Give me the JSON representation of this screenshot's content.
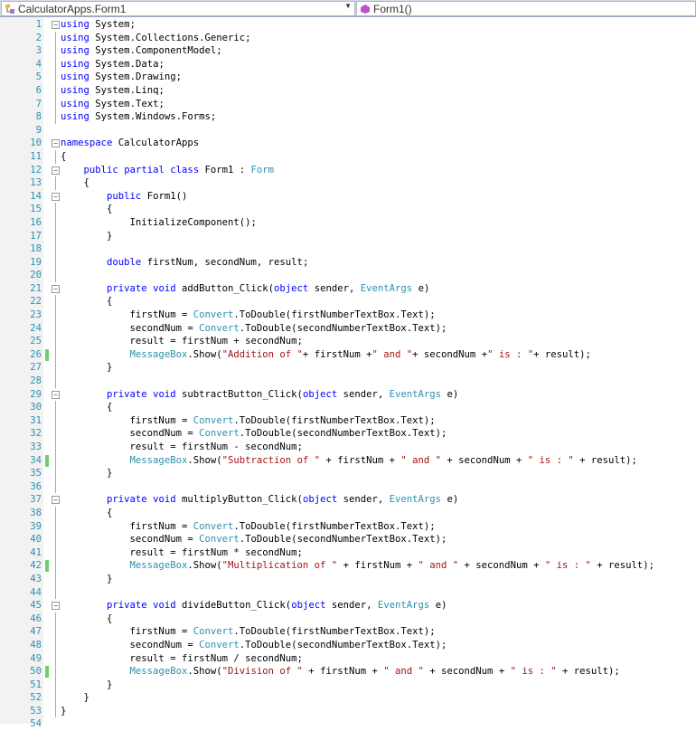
{
  "nav": {
    "class_selector": "CalculatorApps.Form1",
    "member_selector": "Form1()",
    "class_icon": "class-icon",
    "member_icon": "method-icon"
  },
  "changed_lines": [
    26,
    34,
    42,
    50
  ],
  "fold_lines": [
    1,
    10,
    12,
    14,
    21,
    29,
    37,
    45
  ],
  "code": [
    "using System;",
    "using System.Collections.Generic;",
    "using System.ComponentModel;",
    "using System.Data;",
    "using System.Drawing;",
    "using System.Linq;",
    "using System.Text;",
    "using System.Windows.Forms;",
    "",
    "namespace CalculatorApps",
    "{",
    "    public partial class Form1 : Form",
    "    {",
    "        public Form1()",
    "        {",
    "            InitializeComponent();",
    "        }",
    "",
    "        double firstNum, secondNum, result;",
    "",
    "        private void addButton_Click(object sender, EventArgs e)",
    "        {",
    "            firstNum = Convert.ToDouble(firstNumberTextBox.Text);",
    "            secondNum = Convert.ToDouble(secondNumberTextBox.Text);",
    "            result = firstNum + secondNum;",
    "            MessageBox.Show(\"Addition of \"+ firstNum +\" and \"+ secondNum +\" is : \"+ result);",
    "        }",
    "",
    "        private void subtractButton_Click(object sender, EventArgs e)",
    "        {",
    "            firstNum = Convert.ToDouble(firstNumberTextBox.Text);",
    "            secondNum = Convert.ToDouble(secondNumberTextBox.Text);",
    "            result = firstNum - secondNum;",
    "            MessageBox.Show(\"Subtraction of \" + firstNum + \" and \" + secondNum + \" is : \" + result);",
    "        }",
    "",
    "        private void multiplyButton_Click(object sender, EventArgs e)",
    "        {",
    "            firstNum = Convert.ToDouble(firstNumberTextBox.Text);",
    "            secondNum = Convert.ToDouble(secondNumberTextBox.Text);",
    "            result = firstNum * secondNum;",
    "            MessageBox.Show(\"Multiplication of \" + firstNum + \" and \" + secondNum + \" is : \" + result);",
    "        }",
    "",
    "        private void divideButton_Click(object sender, EventArgs e)",
    "        {",
    "            firstNum = Convert.ToDouble(firstNumberTextBox.Text);",
    "            secondNum = Convert.ToDouble(secondNumberTextBox.Text);",
    "            result = firstNum / secondNum;",
    "            MessageBox.Show(\"Division of \" + firstNum + \" and \" + secondNum + \" is : \" + result);",
    "        }",
    "    }",
    "}",
    ""
  ]
}
